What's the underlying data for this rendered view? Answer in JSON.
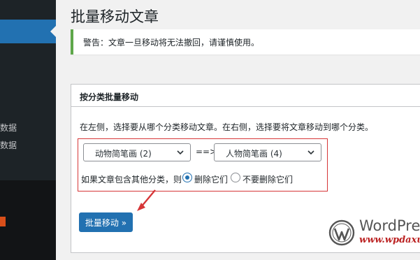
{
  "sidebar": {
    "items": [
      {
        "label": "数据"
      },
      {
        "label": "数据"
      }
    ]
  },
  "page": {
    "title": "批量移动文章"
  },
  "notice": {
    "text": "警告：文章一旦移动将无法撤回，请谨慎使用。"
  },
  "card": {
    "title": "按分类批量移动",
    "description": "在左侧，选择要从哪个分类移动文章。在右侧，选择要将文章移动到哪个分类。",
    "source_select": {
      "value": "动物简笔画 (2)"
    },
    "arrow": "==>",
    "target_select": {
      "value": "人物简笔画 (4)"
    },
    "other_categories_label": "如果文章包含其他分类，则",
    "radio_delete": {
      "label": "删除它们",
      "selected": true
    },
    "radio_keep": {
      "label": "不要删除它们",
      "selected": false
    },
    "submit_label": "批量移动 »"
  },
  "watermark": {
    "name": "WordPress",
    "url": "www.wpdaxue"
  },
  "colors": {
    "accent": "#2271b1",
    "highlight_box": "#d63638",
    "sidebar_bg": "#1d2327",
    "notice_border": "#5ea74a"
  }
}
